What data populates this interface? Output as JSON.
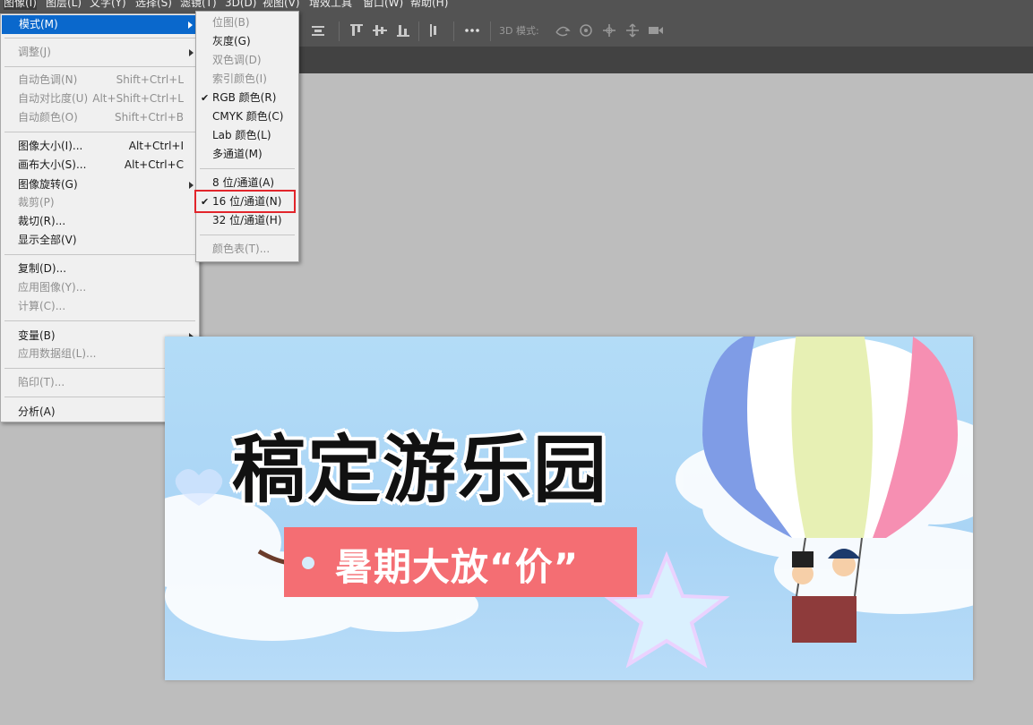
{
  "menubar": {
    "items": [
      "图像(I)",
      "图层(L)",
      "文字(Y)",
      "选择(S)",
      "滤镜(T)",
      "3D(D)",
      "视图(V)",
      "增效工具",
      "窗口(W)",
      "帮助(H)"
    ]
  },
  "options": {
    "mode3d_label": "3D 模式:"
  },
  "main_menu": {
    "items": [
      {
        "label": "模式(M)",
        "shortcut": "",
        "submenu": true,
        "disabled": false,
        "highlighted": true
      },
      {
        "label": "调整(J)",
        "shortcut": "",
        "submenu": true,
        "disabled": true
      },
      {
        "label": "自动色调(N)",
        "shortcut": "Shift+Ctrl+L",
        "disabled": true
      },
      {
        "label": "自动对比度(U)",
        "shortcut": "Alt+Shift+Ctrl+L",
        "disabled": true
      },
      {
        "label": "自动颜色(O)",
        "shortcut": "Shift+Ctrl+B",
        "disabled": true
      },
      {
        "label": "图像大小(I)...",
        "shortcut": "Alt+Ctrl+I",
        "disabled": false
      },
      {
        "label": "画布大小(S)...",
        "shortcut": "Alt+Ctrl+C",
        "disabled": false
      },
      {
        "label": "图像旋转(G)",
        "shortcut": "",
        "submenu": true,
        "disabled": false
      },
      {
        "label": "裁剪(P)",
        "shortcut": "",
        "disabled": true
      },
      {
        "label": "裁切(R)...",
        "shortcut": "",
        "disabled": false
      },
      {
        "label": "显示全部(V)",
        "shortcut": "",
        "disabled": false
      },
      {
        "label": "复制(D)...",
        "shortcut": "",
        "disabled": false
      },
      {
        "label": "应用图像(Y)...",
        "shortcut": "",
        "disabled": true
      },
      {
        "label": "计算(C)...",
        "shortcut": "",
        "disabled": true
      },
      {
        "label": "变量(B)",
        "shortcut": "",
        "submenu": true,
        "disabled": false
      },
      {
        "label": "应用数据组(L)...",
        "shortcut": "",
        "disabled": true
      },
      {
        "label": "陷印(T)...",
        "shortcut": "",
        "disabled": true
      },
      {
        "label": "分析(A)",
        "shortcut": "",
        "submenu": true,
        "disabled": false
      }
    ]
  },
  "mode_submenu": {
    "items": [
      {
        "label": "位图(B)",
        "checked": false,
        "disabled": true
      },
      {
        "label": "灰度(G)",
        "checked": false,
        "disabled": false
      },
      {
        "label": "双色调(D)",
        "checked": false,
        "disabled": true
      },
      {
        "label": "索引颜色(I)",
        "checked": false,
        "disabled": true
      },
      {
        "label": "RGB 颜色(R)",
        "checked": true,
        "disabled": false
      },
      {
        "label": "CMYK 颜色(C)",
        "checked": false,
        "disabled": false
      },
      {
        "label": "Lab 颜色(L)",
        "checked": false,
        "disabled": false
      },
      {
        "label": "多通道(M)",
        "checked": false,
        "disabled": false
      },
      {
        "label": "8 位/通道(A)",
        "checked": false,
        "disabled": false
      },
      {
        "label": "16 位/通道(N)",
        "checked": true,
        "disabled": false
      },
      {
        "label": "32 位/通道(H)",
        "checked": false,
        "disabled": false
      },
      {
        "label": "颜色表(T)...",
        "checked": false,
        "disabled": true
      }
    ],
    "check_mark": "✔"
  },
  "banner": {
    "title": "稿定游乐园",
    "tagline": "暑期大放“价”"
  },
  "colors": {
    "menu_highlight": "#0a68cc",
    "selection_box": "#e2252b",
    "tag": "#f46e73",
    "sky": "#b3dcf7"
  }
}
